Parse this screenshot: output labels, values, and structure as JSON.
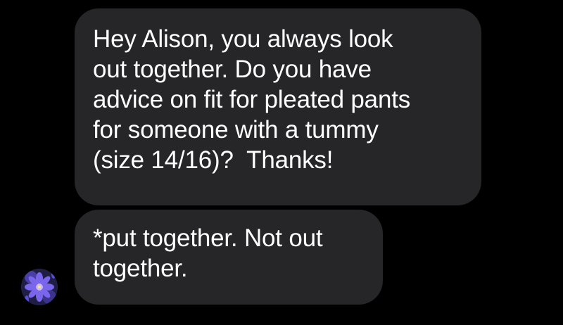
{
  "messages": [
    {
      "lines": [
        "Hey Alison, you always look",
        "out together. Do you have",
        "advice on fit for pleated pants",
        "for someone with a tummy",
        "(size 14/16)?  Thanks!"
      ]
    },
    {
      "lines": [
        "*put together. Not out",
        "together."
      ]
    }
  ],
  "sender": {
    "avatar_icon": "purple-flower-photo-icon"
  },
  "colors": {
    "background": "#000000",
    "bubble": "#262628",
    "text": "#ffffff",
    "avatar_flower": "#6f5be0"
  }
}
